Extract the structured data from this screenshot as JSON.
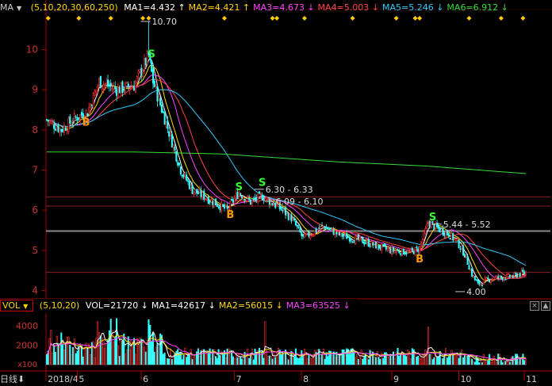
{
  "price_header": {
    "indicator": "MA",
    "params": "(5,10,20,30,60,250)",
    "items": [
      {
        "label": "MA1=4.432",
        "arrow": "↑",
        "color": "#ffffff"
      },
      {
        "label": "MA2=4.421",
        "arrow": "↑",
        "color": "#ffd700"
      },
      {
        "label": "MA3=4.673",
        "arrow": "↓",
        "color": "#ff44ff"
      },
      {
        "label": "MA4=5.003",
        "arrow": "↓",
        "color": "#ff4444"
      },
      {
        "label": "MA5=5.246",
        "arrow": "↓",
        "color": "#33ccff"
      },
      {
        "label": "MA6=6.912",
        "arrow": "↓",
        "color": "#33dd33"
      }
    ],
    "param_colors": [
      "#ffffff",
      "#ffd700",
      "#ff44ff",
      "#ff4444",
      "#33ccff",
      "#33dd33"
    ]
  },
  "volume_header": {
    "indicator": "VOL",
    "params": "(5,10,20)",
    "items": [
      {
        "label": "VOL=21720",
        "arrow": "↓",
        "color": "#ffffff"
      },
      {
        "label": "MA1=42617",
        "arrow": "↓",
        "color": "#ffffff"
      },
      {
        "label": "MA2=56015",
        "arrow": "↓",
        "color": "#ffd700"
      },
      {
        "label": "MA3=63525",
        "arrow": "↓",
        "color": "#ff44ff"
      }
    ]
  },
  "bottom_bar": {
    "period_label": "日线",
    "date_labels": [
      {
        "text": "2018/4",
        "x": 0
      },
      {
        "text": "5",
        "x": 22
      },
      {
        "text": "6",
        "x": 66
      },
      {
        "text": "7",
        "x": 130
      },
      {
        "text": "8",
        "x": 176
      },
      {
        "text": "9",
        "x": 238
      },
      {
        "text": "10",
        "x": 284
      },
      {
        "text": "11",
        "x": 329
      }
    ]
  },
  "chart_data": [
    {
      "type": "candlestick",
      "title": "",
      "ylim": [
        3.85,
        10.8
      ],
      "yticks": [
        4,
        5,
        6,
        7,
        8,
        9,
        10
      ],
      "n_bars": 330,
      "annotations": [
        {
          "text": "10.70",
          "x": 70,
          "y": 10.7
        },
        {
          "text": "6.30 - 6.33",
          "x": 148,
          "y": 6.52
        },
        {
          "text": "6.09 - 6.10",
          "x": 155,
          "y": 6.22
        },
        {
          "text": "5.44 - 5.52",
          "x": 270,
          "y": 5.65
        },
        {
          "text": "4.00",
          "x": 286,
          "y": 3.97
        }
      ],
      "signals": [
        {
          "text": "S",
          "x": 72,
          "y": 9.8,
          "color": "#33ff33"
        },
        {
          "text": "B",
          "x": 27,
          "y": 8.1,
          "color": "#ff9900"
        },
        {
          "text": "S",
          "x": 132,
          "y": 6.5,
          "color": "#33ff33"
        },
        {
          "text": "S",
          "x": 148,
          "y": 6.6,
          "color": "#33ff33"
        },
        {
          "text": "B",
          "x": 126,
          "y": 5.8,
          "color": "#ff9900"
        },
        {
          "text": "B",
          "x": 256,
          "y": 4.7,
          "color": "#ff9900"
        },
        {
          "text": "S",
          "x": 265,
          "y": 5.75,
          "color": "#33ff33"
        }
      ],
      "ref_lines": [
        6.33,
        6.1,
        5.48,
        4.45
      ],
      "key_points": [
        [
          0,
          8.25
        ],
        [
          10,
          8.0
        ],
        [
          20,
          8.3
        ],
        [
          28,
          8.45
        ],
        [
          36,
          9.2
        ],
        [
          48,
          9.0
        ],
        [
          60,
          9.1
        ],
        [
          70,
          9.85
        ],
        [
          73,
          9.2
        ],
        [
          80,
          8.4
        ],
        [
          86,
          7.7
        ],
        [
          92,
          7.0
        ],
        [
          100,
          6.5
        ],
        [
          110,
          6.3
        ],
        [
          124,
          6.0
        ],
        [
          132,
          6.45
        ],
        [
          140,
          6.2
        ],
        [
          148,
          6.35
        ],
        [
          160,
          6.05
        ],
        [
          168,
          5.8
        ],
        [
          176,
          5.3
        ],
        [
          190,
          5.6
        ],
        [
          200,
          5.4
        ],
        [
          215,
          5.25
        ],
        [
          235,
          5.0
        ],
        [
          250,
          4.95
        ],
        [
          256,
          5.05
        ],
        [
          262,
          5.7
        ],
        [
          268,
          5.55
        ],
        [
          276,
          5.4
        ],
        [
          282,
          5.2
        ],
        [
          287,
          4.9
        ],
        [
          292,
          4.4
        ],
        [
          296,
          4.15
        ],
        [
          305,
          4.3
        ],
        [
          320,
          4.35
        ],
        [
          329,
          4.45
        ]
      ],
      "ma250_points": [
        [
          0,
          7.45
        ],
        [
          60,
          7.45
        ],
        [
          120,
          7.4
        ],
        [
          200,
          7.2
        ],
        [
          260,
          7.1
        ],
        [
          329,
          6.91
        ]
      ]
    },
    {
      "type": "bar",
      "title": "",
      "ylim": [
        0,
        5200
      ],
      "yticks": [
        2000,
        4000
      ],
      "ytick_labels": [
        "2000",
        "4000"
      ],
      "unit_label": "x100"
    }
  ]
}
